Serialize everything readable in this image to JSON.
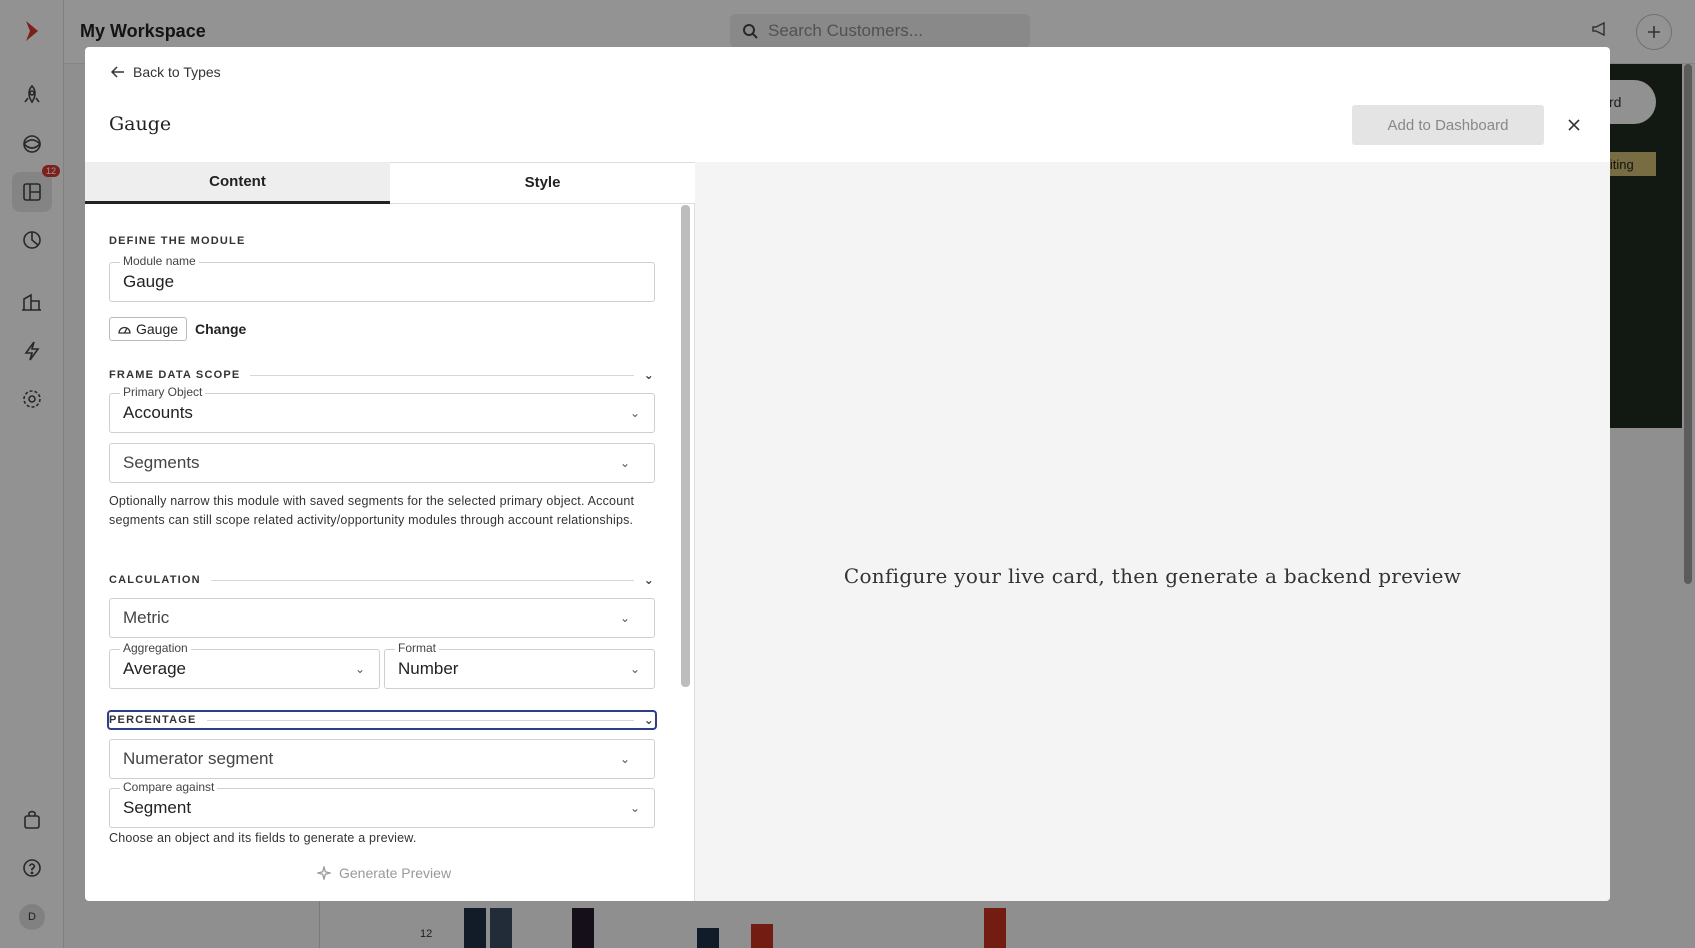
{
  "app": {
    "workspace_title": "My Workspace",
    "search_placeholder": "Search Customers...",
    "notification_badge": "12",
    "avatar_initial": "D",
    "discard_label": "Discard",
    "editing_label": "Editing",
    "axis_tick": "12"
  },
  "modal": {
    "back_label": "Back to Types",
    "title": "Gauge",
    "add_button": "Add to Dashboard",
    "tabs": [
      {
        "label": "Content",
        "active": true
      },
      {
        "label": "Style",
        "active": false
      }
    ],
    "define_section": "DEFINE THE MODULE",
    "module_name_label": "Module name",
    "module_name_value": "Gauge",
    "type_chip": "Gauge",
    "change_label": "Change",
    "scope_section": "FRAME DATA SCOPE",
    "primary_object_label": "Primary Object",
    "primary_object_value": "Accounts",
    "segments_placeholder": "Segments",
    "scope_help": "Optionally narrow this module with saved segments for the selected primary object. Account segments can still scope related activity/opportunity modules through account relationships.",
    "calc_section": "CALCULATION",
    "metric_placeholder": "Metric",
    "aggregation_label": "Aggregation",
    "aggregation_value": "Average",
    "format_label": "Format",
    "format_value": "Number",
    "percentage_section": "PERCENTAGE",
    "numerator_placeholder": "Numerator segment",
    "compare_label": "Compare against",
    "compare_value": "Segment",
    "footer_help": "Choose an object and its fields to generate a preview.",
    "generate_label": "Generate Preview",
    "preview_message": "Configure your live card, then generate a backend preview"
  },
  "colors": {
    "accent_dark": "#1d2a1f",
    "bar_navy": "#1f2f45",
    "bar_red": "#c0301f",
    "focus": "#2c3e8c"
  }
}
